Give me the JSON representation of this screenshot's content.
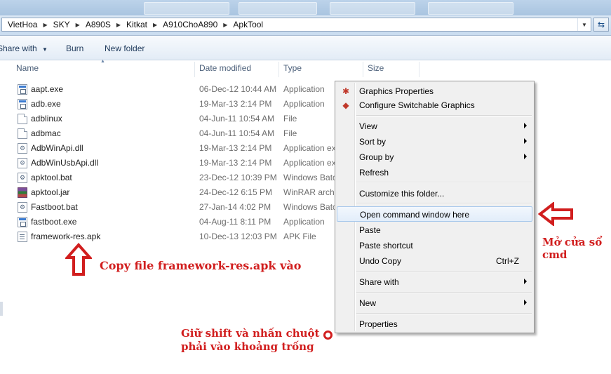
{
  "address": {
    "crumbs": [
      "VietHoa",
      "SKY",
      "A890S",
      "Kitkat",
      "A910ChoA890",
      "ApkTool"
    ]
  },
  "toolbar": {
    "share_label": "Share with",
    "burn_label": "Burn",
    "new_folder_label": "New folder"
  },
  "columns": {
    "name": "Name",
    "date": "Date modified",
    "type": "Type",
    "size": "Size"
  },
  "files": [
    {
      "name": "aapt.exe",
      "date": "06-Dec-12 10:44 AM",
      "type": "Application",
      "icon": "exe-icon"
    },
    {
      "name": "adb.exe",
      "date": "19-Mar-13 2:14 PM",
      "type": "Application",
      "icon": "exe-icon"
    },
    {
      "name": "adblinux",
      "date": "04-Jun-11 10:54 AM",
      "type": "File",
      "icon": "file-icon"
    },
    {
      "name": "adbmac",
      "date": "04-Jun-11 10:54 AM",
      "type": "File",
      "icon": "file-icon"
    },
    {
      "name": "AdbWinApi.dll",
      "date": "19-Mar-13 2:14 PM",
      "type": "Application ex",
      "icon": "dll-icon"
    },
    {
      "name": "AdbWinUsbApi.dll",
      "date": "19-Mar-13 2:14 PM",
      "type": "Application ex",
      "icon": "dll-icon"
    },
    {
      "name": "apktool.bat",
      "date": "23-Dec-12 10:39 PM",
      "type": "Windows Batc",
      "icon": "bat-icon"
    },
    {
      "name": "apktool.jar",
      "date": "24-Dec-12 6:15 PM",
      "type": "WinRAR archi",
      "icon": "winrar-icon"
    },
    {
      "name": "Fastboot.bat",
      "date": "27-Jan-14 4:02 PM",
      "type": "Windows Batc",
      "icon": "bat-icon"
    },
    {
      "name": "fastboot.exe",
      "date": "04-Aug-11 8:11 PM",
      "type": "Application",
      "icon": "exe-icon"
    },
    {
      "name": "framework-res.apk",
      "date": "10-Dec-13 12:03 PM",
      "type": "APK File",
      "icon": "apk-icon"
    }
  ],
  "context_menu": {
    "graphics_properties": "Graphics Properties",
    "switchable_graphics": "Configure Switchable Graphics",
    "view": "View",
    "sort_by": "Sort by",
    "group_by": "Group by",
    "refresh": "Refresh",
    "customize": "Customize this folder...",
    "open_cmd": "Open command window here",
    "paste": "Paste",
    "paste_shortcut": "Paste shortcut",
    "undo_copy": "Undo Copy",
    "undo_shortcut": "Ctrl+Z",
    "share_with": "Share with",
    "new": "New",
    "properties": "Properties"
  },
  "annotations": {
    "copy_note": "Copy file framework-res.apk vào",
    "open_note_line1": "Mở cửa sổ",
    "open_note_line2": "cmd",
    "shift_note_line1": "Giữ shift và nhấn chuột",
    "shift_note_line2": "phải vào khoảng trống"
  },
  "colors": {
    "annotation": "#d11e1e",
    "menu_highlight": "#e2edfa"
  }
}
